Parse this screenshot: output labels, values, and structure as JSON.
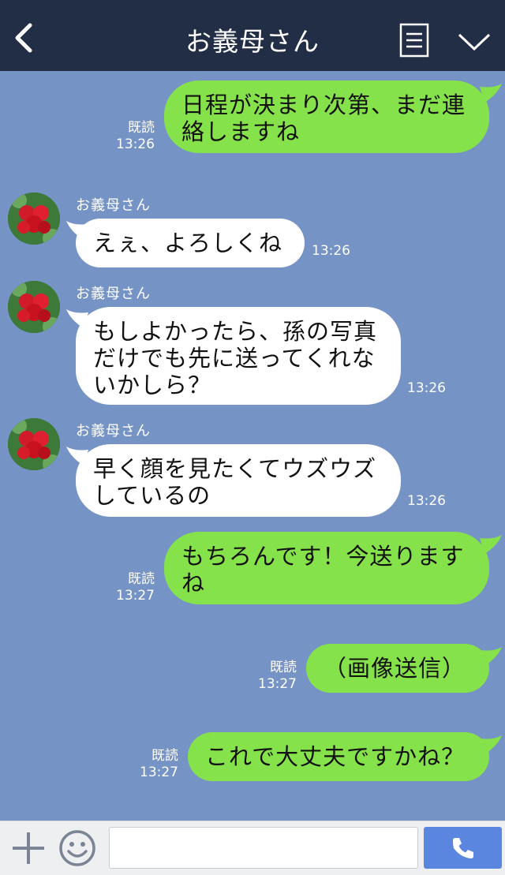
{
  "header": {
    "title": "お義母さん",
    "back_icon": "chevron-left-icon",
    "menu_icon": "list-icon",
    "collapse_icon": "chevron-down-icon",
    "background": "#222d46"
  },
  "colors": {
    "chat_background": "#7594c5",
    "outgoing_bubble": "#86e24a",
    "incoming_bubble": "#ffffff",
    "call_button": "#5a86e0"
  },
  "messages": [
    {
      "direction": "out",
      "line1": "日程が決まり次第、まだ連",
      "line2": "絡しますね",
      "read": "既読",
      "time": "13:26"
    },
    {
      "direction": "in",
      "sender": "お義母さん",
      "line1": "えぇ、よろしくね",
      "time": "13:26"
    },
    {
      "direction": "in",
      "sender": "お義母さん",
      "line1": "もしよかったら、孫の写真",
      "line2": "だけでも先に送ってくれな",
      "line3": "いかしら？",
      "time": "13:26"
    },
    {
      "direction": "in",
      "sender": "お義母さん",
      "line1": "早く顔を見たくてウズウズ",
      "line2": "しているの",
      "time": "13:26"
    },
    {
      "direction": "out",
      "line1": "もちろんです！今送ります",
      "line2": "ね",
      "read": "既読",
      "time": "13:27"
    },
    {
      "direction": "out",
      "line1": "（画像送信）",
      "read": "既読",
      "time": "13:27"
    },
    {
      "direction": "out",
      "line1": "これで大丈夫ですかね？",
      "read": "既読",
      "time": "13:27"
    }
  ],
  "footer": {
    "plus_icon": "plus-icon",
    "emoji_icon": "smiley-icon",
    "input_value": "",
    "input_placeholder": "",
    "call_icon": "phone-icon"
  }
}
